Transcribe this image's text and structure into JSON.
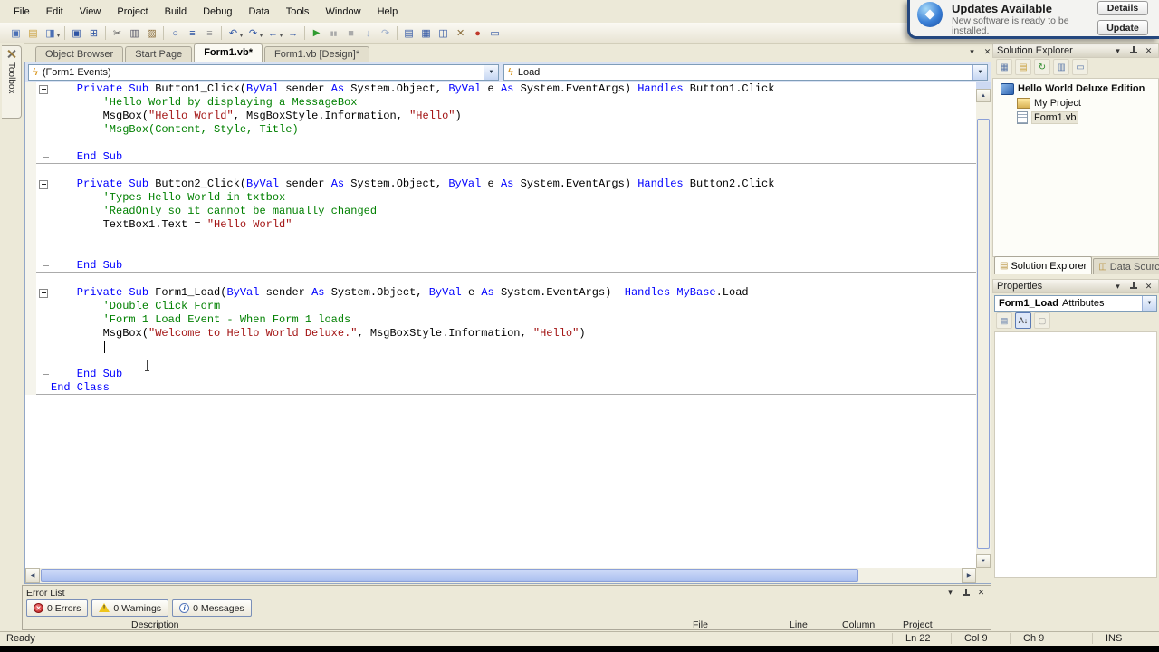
{
  "menu": {
    "items": [
      "File",
      "Edit",
      "View",
      "Project",
      "Build",
      "Debug",
      "Data",
      "Tools",
      "Window",
      "Help"
    ]
  },
  "toolbar": {
    "icons": [
      {
        "name": "new-project",
        "glyph": "▣",
        "color": "#4a6fb5"
      },
      {
        "name": "open-file",
        "glyph": "▤",
        "color": "#c9a03e"
      },
      {
        "name": "add-item",
        "glyph": "◨",
        "color": "#4a6fb5",
        "dd": true
      },
      {
        "sep": true
      },
      {
        "name": "save",
        "glyph": "▣",
        "color": "#2f55a4"
      },
      {
        "name": "save-all",
        "glyph": "⊞",
        "color": "#2f55a4"
      },
      {
        "sep": true
      },
      {
        "name": "cut",
        "glyph": "✂",
        "color": "#555555"
      },
      {
        "name": "copy",
        "glyph": "▥",
        "color": "#556"
      },
      {
        "name": "paste",
        "glyph": "▨",
        "color": "#8a6d3b"
      },
      {
        "sep": true
      },
      {
        "name": "find",
        "glyph": "○",
        "color": "#2f55a4"
      },
      {
        "name": "comment",
        "glyph": "≡",
        "color": "#2f55a4"
      },
      {
        "name": "uncomment",
        "glyph": "≡",
        "color": "#999999"
      },
      {
        "sep": true
      },
      {
        "name": "undo",
        "glyph": "↶",
        "color": "#2f55a4",
        "dd": true
      },
      {
        "name": "redo",
        "glyph": "↷",
        "color": "#2f55a4",
        "dd": true
      },
      {
        "name": "navigate-back",
        "glyph": "←",
        "color": "#2f55a4",
        "dd": true
      },
      {
        "name": "navigate-forward",
        "glyph": "→",
        "color": "#2f55a4"
      },
      {
        "sep": true
      },
      {
        "name": "start-debug",
        "glyph": "▶",
        "color": "#2f9b2f"
      },
      {
        "name": "pause",
        "glyph": "▮▮",
        "color": "#aaaaaa"
      },
      {
        "name": "stop",
        "glyph": "■",
        "color": "#aaaaaa"
      },
      {
        "name": "step-into",
        "glyph": "↓",
        "color": "#9fb0cc"
      },
      {
        "name": "step-over",
        "glyph": "↷",
        "color": "#9fb0cc"
      },
      {
        "sep": true
      },
      {
        "name": "solution-explorer",
        "glyph": "▤",
        "color": "#2f55a4"
      },
      {
        "name": "properties-window",
        "glyph": "▦",
        "color": "#2f55a4"
      },
      {
        "name": "object-browser",
        "glyph": "◫",
        "color": "#2f55a4"
      },
      {
        "name": "toolbox",
        "glyph": "✕",
        "color": "#8a6d3b"
      },
      {
        "name": "error-list",
        "glyph": "●",
        "color": "#c0392b"
      },
      {
        "name": "command-window",
        "glyph": "▭",
        "color": "#2f55a4"
      }
    ]
  },
  "toolbox_tab": {
    "label": "Toolbox"
  },
  "document_tabs": {
    "items": [
      {
        "label": "Object Browser"
      },
      {
        "label": "Start Page"
      },
      {
        "label": "Form1.vb*",
        "active": true
      },
      {
        "label": "Form1.vb [Design]*"
      }
    ]
  },
  "editor": {
    "object_dropdown": "(Form1 Events)",
    "event_dropdown": "Load",
    "lines": [
      {
        "o": "m",
        "segs": [
          [
            "k",
            "    Private Sub "
          ],
          [
            "t",
            "Button1_Click("
          ],
          [
            "k",
            "ByVal "
          ],
          [
            "t",
            "sender "
          ],
          [
            "k",
            "As "
          ],
          [
            "t",
            "System.Object, "
          ],
          [
            "k",
            "ByVal "
          ],
          [
            "t",
            "e "
          ],
          [
            "k",
            "As "
          ],
          [
            "t",
            "System.EventArgs) "
          ],
          [
            "k",
            "Handles "
          ],
          [
            "t",
            "Button1.Click"
          ]
        ]
      },
      {
        "o": "l",
        "segs": [
          [
            "c",
            "        'Hello World by displaying a MessageBox"
          ]
        ]
      },
      {
        "o": "l",
        "segs": [
          [
            "t",
            "        MsgBox("
          ],
          [
            "s",
            "\"Hello World\""
          ],
          [
            "t",
            ", MsgBoxStyle.Information, "
          ],
          [
            "s",
            "\"Hello\""
          ],
          [
            "t",
            ")"
          ]
        ]
      },
      {
        "o": "l",
        "segs": [
          [
            "c",
            "        'MsgBox(Content, Style, Title)"
          ]
        ]
      },
      {
        "o": "l",
        "segs": []
      },
      {
        "o": "e",
        "segs": [
          [
            "k",
            "    End Sub"
          ]
        ],
        "div": true
      },
      {
        "o": "l",
        "segs": []
      },
      {
        "o": "m",
        "segs": [
          [
            "k",
            "    Private Sub "
          ],
          [
            "t",
            "Button2_Click("
          ],
          [
            "k",
            "ByVal "
          ],
          [
            "t",
            "sender "
          ],
          [
            "k",
            "As "
          ],
          [
            "t",
            "System.Object, "
          ],
          [
            "k",
            "ByVal "
          ],
          [
            "t",
            "e "
          ],
          [
            "k",
            "As "
          ],
          [
            "t",
            "System.EventArgs) "
          ],
          [
            "k",
            "Handles "
          ],
          [
            "t",
            "Button2.Click"
          ]
        ]
      },
      {
        "o": "l",
        "segs": [
          [
            "c",
            "        'Types Hello World in txtbox"
          ]
        ]
      },
      {
        "o": "l",
        "segs": [
          [
            "c",
            "        'ReadOnly so it cannot be manually changed"
          ]
        ]
      },
      {
        "o": "l",
        "segs": [
          [
            "t",
            "        TextBox1.Text = "
          ],
          [
            "s",
            "\"Hello World\""
          ]
        ]
      },
      {
        "o": "l",
        "segs": []
      },
      {
        "o": "l",
        "segs": []
      },
      {
        "o": "e",
        "segs": [
          [
            "k",
            "    End Sub"
          ]
        ],
        "div": true
      },
      {
        "o": "l",
        "segs": []
      },
      {
        "o": "m",
        "segs": [
          [
            "k",
            "    Private Sub "
          ],
          [
            "t",
            "Form1_Load("
          ],
          [
            "k",
            "ByVal "
          ],
          [
            "t",
            "sender "
          ],
          [
            "k",
            "As "
          ],
          [
            "t",
            "System.Object, "
          ],
          [
            "k",
            "ByVal "
          ],
          [
            "t",
            "e "
          ],
          [
            "k",
            "As "
          ],
          [
            "t",
            "System.EventArgs)  "
          ],
          [
            "k",
            "Handles MyBase"
          ],
          [
            "t",
            ".Load"
          ]
        ]
      },
      {
        "o": "l",
        "segs": [
          [
            "c",
            "        'Double Click Form"
          ]
        ]
      },
      {
        "o": "l",
        "segs": [
          [
            "c",
            "        'Form 1 Load Event - When Form 1 loads"
          ]
        ]
      },
      {
        "o": "l",
        "segs": [
          [
            "t",
            "        MsgBox("
          ],
          [
            "s",
            "\"Welcome to Hello World Deluxe.\""
          ],
          [
            "t",
            ", MsgBoxStyle.Information, "
          ],
          [
            "s",
            "\"Hello\""
          ],
          [
            "t",
            ")"
          ]
        ]
      },
      {
        "o": "l",
        "segs": [],
        "caret": 8
      },
      {
        "o": "l",
        "segs": []
      },
      {
        "o": "e",
        "segs": [
          [
            "k",
            "    End Sub"
          ]
        ]
      },
      {
        "o": "c",
        "segs": [
          [
            "k",
            "End Class"
          ]
        ],
        "div": true
      }
    ]
  },
  "notification": {
    "title": "Updates Available",
    "message": "New software is ready to be installed.",
    "details_button": "Details",
    "update_button": "Update"
  },
  "solution_explorer": {
    "title": "Solution Explorer",
    "toolbar_icons": [
      {
        "name": "properties",
        "glyph": "▦",
        "color": "#5a77a8"
      },
      {
        "name": "show-all-files",
        "glyph": "▤",
        "color": "#c9a03e"
      },
      {
        "name": "refresh",
        "glyph": "↻",
        "color": "#2e8b2e"
      },
      {
        "name": "view-code",
        "glyph": "▥",
        "color": "#5a77a8"
      },
      {
        "name": "view-designer",
        "glyph": "▭",
        "color": "#5a77a8"
      }
    ],
    "tree": [
      {
        "label": "Hello World Deluxe Edition",
        "icon": "vb-project",
        "bold": true,
        "indent": 0
      },
      {
        "label": "My Project",
        "icon": "my-project",
        "indent": 1
      },
      {
        "label": "Form1.vb",
        "icon": "form-file",
        "indent": 1,
        "selected": true
      }
    ]
  },
  "panel_tabs": {
    "items": [
      {
        "label": "Solution Explorer",
        "icon": "▤",
        "active": true
      },
      {
        "label": "Data Sources",
        "icon": "◫"
      }
    ]
  },
  "properties": {
    "title": "Properties",
    "object_name": "Form1_Load",
    "object_kind": "Attributes",
    "toolbar_icons": [
      {
        "name": "categorized",
        "glyph": "▤",
        "color": "#5a77a8"
      },
      {
        "name": "alphabetical",
        "glyph": "A↓",
        "color": "#333333",
        "pressed": true
      },
      {
        "name": "property-pages",
        "glyph": "▢",
        "color": "#999999"
      }
    ]
  },
  "error_list": {
    "title": "Error List",
    "filters": [
      {
        "name": "errors",
        "label": "0 Errors"
      },
      {
        "name": "warnings",
        "label": "0 Warnings"
      },
      {
        "name": "messages",
        "label": "0 Messages"
      }
    ],
    "columns": [
      "Description",
      "File",
      "Line",
      "Column",
      "Project"
    ]
  },
  "status_bar": {
    "message": "Ready",
    "line": "Ln 22",
    "column": "Col 9",
    "character": "Ch 9",
    "mode": "INS"
  },
  "colors": {
    "keyword": "#0000ff",
    "comment": "#008000",
    "string": "#a31515",
    "chrome": "#ece9d8"
  }
}
